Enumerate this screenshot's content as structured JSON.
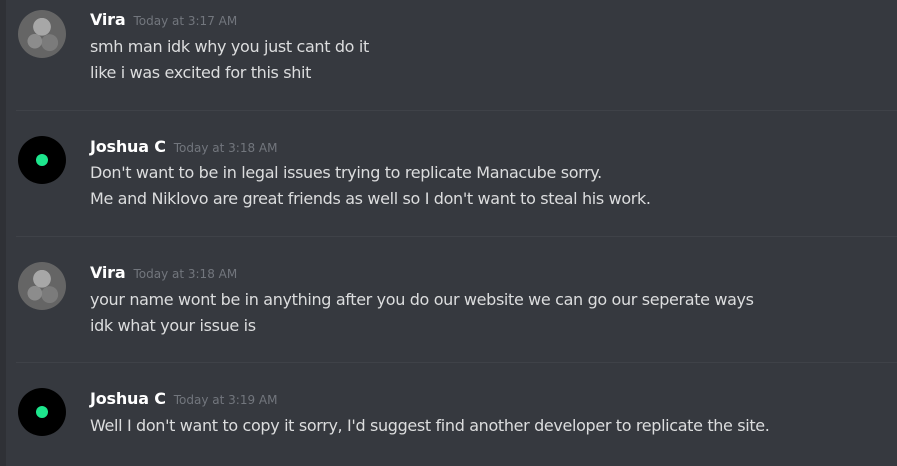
{
  "messages": [
    {
      "author": "Vira",
      "timestamp": "Today at 3:17 AM",
      "avatar": "gray-photo-avatar",
      "lines": [
        "smh man idk why you just cant do it",
        "like i was excited for this shit"
      ]
    },
    {
      "author": "Joshua C",
      "timestamp": "Today at 3:18 AM",
      "avatar": "black-avatar-with-green-dot",
      "lines": [
        "Don't want to be in legal issues trying to replicate Manacube sorry.",
        "Me and Niklovo are great friends as well so I don't want to steal his work."
      ]
    },
    {
      "author": "Vira",
      "timestamp": "Today at 3:18 AM",
      "avatar": "gray-photo-avatar",
      "lines": [
        "your name wont be in anything after you do our website we can go our seperate ways",
        "idk what your issue is"
      ]
    },
    {
      "author": "Joshua C",
      "timestamp": "Today at 3:19 AM",
      "avatar": "black-avatar-with-green-dot",
      "lines": [
        "Well I don't want to copy it sorry, I'd suggest find another developer to replicate the site."
      ]
    }
  ],
  "colors": {
    "background": "#36393f",
    "username": "#ffffff",
    "timestamp": "#72767d",
    "message_text": "#dcddde",
    "status_green": "#1de68d"
  }
}
